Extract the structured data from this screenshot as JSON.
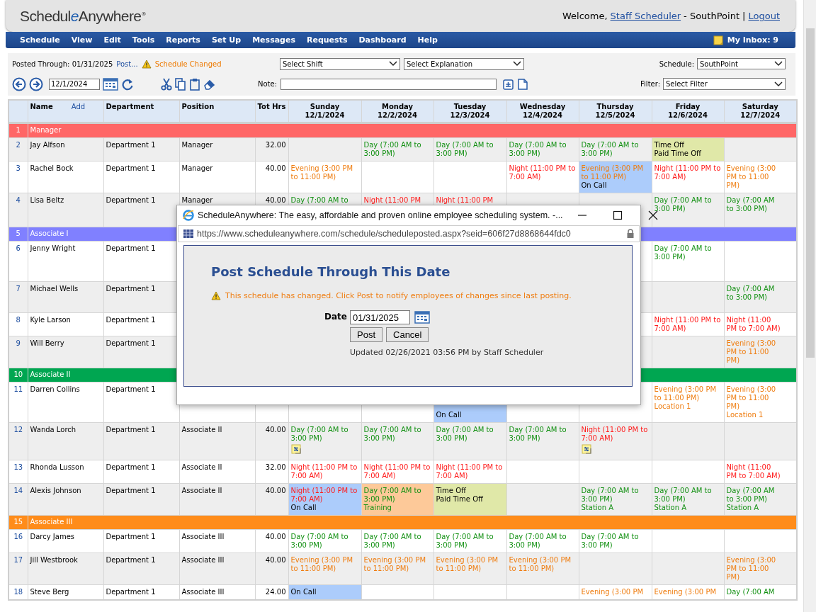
{
  "header": {
    "logo": [
      {
        "text": "Schedul"
      },
      {
        "text": "e",
        "accent": true
      },
      {
        "text": "Anywhere"
      }
    ],
    "logo_mark": "®",
    "welcome": "Welcome,",
    "user_link": "Staff Scheduler",
    "site": "- SouthPoint |",
    "logout_link": "Logout"
  },
  "menu": {
    "items": [
      "Schedule",
      "View",
      "Edit",
      "Tools",
      "Reports",
      "Set Up",
      "Messages",
      "Requests",
      "Dashboard",
      "Help"
    ],
    "inbox": "My Inbox: 9"
  },
  "toolbar": {
    "posted_through": "Posted Through: 01/31/2025",
    "post_link": "Post...",
    "status": "Schedule Changed",
    "shift_select": "Select Shift",
    "explanation_select": "Select Explanation",
    "schedule_label": "Schedule:",
    "schedule_select": "SouthPoint",
    "date_value": "12/1/2024",
    "note_label": "Note:",
    "filter_label": "Filter:",
    "filter_select": "Select Filter"
  },
  "table": {
    "columns": [
      {
        "label": "Name",
        "action": "Add"
      },
      {
        "label": "Department"
      },
      {
        "label": "Position"
      },
      {
        "label": "Tot Hrs"
      }
    ],
    "days": [
      {
        "day": "Sunday",
        "date": "12/1/2024"
      },
      {
        "day": "Monday",
        "date": "12/2/2024"
      },
      {
        "day": "Tuesday",
        "date": "12/3/2024"
      },
      {
        "day": "Wednesday",
        "date": "12/4/2024"
      },
      {
        "day": "Thursday",
        "date": "12/5/2024"
      },
      {
        "day": "Friday",
        "date": "12/6/2024"
      },
      {
        "day": "Saturday",
        "date": "12/7/2024"
      }
    ],
    "rows": [
      {
        "kind": "group",
        "number": "1",
        "label": "Manager",
        "color": "#ff6666"
      },
      {
        "kind": "employee",
        "number": "2",
        "name": "Jay Alfson",
        "department": "Department 1",
        "position": "Manager",
        "hours": "32.00",
        "days": {
          "mon": {
            "lines": [
              {
                "text": "Day (7:00 AM to 3:00 PM)",
                "kind": "day"
              }
            ]
          },
          "tue": {
            "lines": [
              {
                "text": "Day (7:00 AM to 3:00 PM)",
                "kind": "day"
              }
            ]
          },
          "wed": {
            "lines": [
              {
                "text": "Day (7:00 AM to 3:00 PM)",
                "kind": "day"
              }
            ]
          },
          "thu": {
            "lines": [
              {
                "text": "Day (7:00 AM to 3:00 PM)",
                "kind": "day"
              }
            ]
          },
          "fri": {
            "lines": [
              {
                "text": "Time Off",
                "kind": "plain"
              },
              {
                "text": "Paid Time Off",
                "kind": "plain"
              }
            ],
            "color": "#e0e8a8"
          }
        }
      },
      {
        "kind": "employee",
        "number": "3",
        "name": "Rachel Bock",
        "department": "Department 1",
        "position": "Manager",
        "hours": "40.00",
        "days": {
          "sun": {
            "lines": [
              {
                "text": "Evening (3:00 PM to 11:00 PM)",
                "kind": "evening"
              }
            ]
          },
          "wed": {
            "lines": [
              {
                "text": "Night (11:00 PM to 7:00 AM)",
                "kind": "night"
              }
            ]
          },
          "thu": {
            "lines": [
              {
                "text": "Evening (3:00 PM to 11:00 PM)",
                "kind": "evening"
              },
              {
                "text": "On Call",
                "kind": "plain"
              }
            ],
            "color": "#acccfb"
          },
          "fri": {
            "lines": [
              {
                "text": "Night (11:00 PM to 7:00 AM)",
                "kind": "night"
              }
            ]
          },
          "sat": {
            "lines": [
              {
                "text": "Evening (3:00 PM to 11:00 PM)",
                "kind": "evening"
              }
            ]
          }
        }
      },
      {
        "kind": "employee",
        "number": "4",
        "name": "Lisa Beltz",
        "department": "Department 1",
        "position": "Manager",
        "hours": "40.00",
        "days": {
          "sun": {
            "lines": [
              {
                "text": "Day (7:00 AM to",
                "kind": "day"
              }
            ]
          },
          "mon": {
            "lines": [
              {
                "text": "Night (11:00 PM",
                "kind": "night"
              }
            ]
          },
          "tue": {
            "lines": [
              {
                "text": "Night (11:00 PM",
                "kind": "night"
              }
            ]
          },
          "fri": {
            "lines": [
              {
                "text": "Day (7:00 AM to 3:00 PM)",
                "kind": "day"
              }
            ]
          },
          "sat": {
            "lines": [
              {
                "text": "Day (7:00 AM to 3:00 PM)",
                "kind": "day"
              }
            ]
          }
        }
      },
      {
        "kind": "group",
        "number": "5",
        "label": "Associate I",
        "color": "#8080ff"
      },
      {
        "kind": "employee",
        "number": "6",
        "name": "Jenny Wright",
        "department": "Department 1",
        "days": {
          "fri": {
            "lines": [
              {
                "text": "Day (7:00 AM to 3:00 PM)",
                "kind": "day"
              }
            ]
          }
        }
      },
      {
        "kind": "employee",
        "number": "7",
        "name": "Michael Wells",
        "department": "Department 1",
        "days": {
          "sat": {
            "lines": [
              {
                "text": "Day (7:00 AM to 3:00 PM)",
                "kind": "day"
              }
            ]
          }
        }
      },
      {
        "kind": "employee",
        "number": "8",
        "name": "Kyle Larson",
        "department": "Department 1",
        "days": {
          "fri": {
            "lines": [
              {
                "text": "Night (11:00 PM to 7:00 AM)",
                "kind": "night"
              }
            ]
          },
          "sat": {
            "lines": [
              {
                "text": "Night (11:00 PM to 7:00 AM)",
                "kind": "night"
              }
            ]
          }
        }
      },
      {
        "kind": "employee",
        "number": "9",
        "name": "Will Berry",
        "department": "Department 1",
        "days": {
          "sat": {
            "lines": [
              {
                "text": "Evening (3:00 PM to 11:00 PM)",
                "kind": "evening"
              }
            ]
          }
        }
      },
      {
        "kind": "group",
        "number": "10",
        "label": "Associate II",
        "color": "#00a651"
      },
      {
        "kind": "employee",
        "number": "11",
        "name": "Darren Collins",
        "department": "Department 1",
        "days": {
          "tue": {
            "lines": [
              {
                "text": "On Call",
                "kind": "plain"
              }
            ],
            "color": "#acccfb"
          },
          "fri": {
            "lines": [
              {
                "text": "Evening (3:00 PM to 11:00 PM)",
                "kind": "evening"
              },
              {
                "text": "Location 1",
                "kind": "evening"
              }
            ]
          },
          "sat": {
            "lines": [
              {
                "text": "Evening (3:00 PM to 11:00 PM)",
                "kind": "evening"
              },
              {
                "text": "Location 1",
                "kind": "evening"
              }
            ]
          }
        }
      },
      {
        "kind": "employee",
        "number": "12",
        "name": "Wanda Lorch",
        "department": "Department 1",
        "position": "Associate II",
        "hours": "40.00",
        "days": {
          "sun": {
            "lines": [
              {
                "text": "Day (7:00 AM to 3:00 PM)",
                "kind": "day"
              }
            ],
            "note_icon": true
          },
          "mon": {
            "lines": [
              {
                "text": "Day (7:00 AM to 3:00 PM)",
                "kind": "day"
              }
            ]
          },
          "tue": {
            "lines": [
              {
                "text": "Day (7:00 AM to 3:00 PM)",
                "kind": "day"
              }
            ]
          },
          "wed": {
            "lines": [
              {
                "text": "Day (7:00 AM to 3:00 PM)",
                "kind": "day"
              }
            ]
          },
          "thu": {
            "lines": [
              {
                "text": "Night (11:00 PM to 7:00 AM)",
                "kind": "night"
              }
            ],
            "note_icon": true
          }
        }
      },
      {
        "kind": "employee",
        "number": "13",
        "name": "Rhonda Lusson",
        "department": "Department 1",
        "position": "Associate II",
        "hours": "32.00",
        "days": {
          "sun": {
            "lines": [
              {
                "text": "Night (11:00 PM to 7:00 AM)",
                "kind": "night"
              }
            ]
          },
          "mon": {
            "lines": [
              {
                "text": "Night (11:00 PM to 7:00 AM)",
                "kind": "night"
              }
            ]
          },
          "tue": {
            "lines": [
              {
                "text": "Night (11:00 PM to 7:00 AM)",
                "kind": "night"
              }
            ]
          },
          "sat": {
            "lines": [
              {
                "text": "Night (11:00 PM to 7:00 AM)",
                "kind": "night"
              }
            ]
          }
        }
      },
      {
        "kind": "employee",
        "number": "14",
        "name": "Alexis Johnson",
        "department": "Department 1",
        "position": "Associate II",
        "hours": "40.00",
        "days": {
          "sun": {
            "lines": [
              {
                "text": "Night (11:00 PM to 7:00 AM)",
                "kind": "night"
              },
              {
                "text": "On Call",
                "kind": "plain"
              }
            ],
            "color": "#acccfb"
          },
          "mon": {
            "lines": [
              {
                "text": "Day (7:00 AM to 3:00 PM)",
                "kind": "day"
              },
              {
                "text": "Training",
                "kind": "day"
              }
            ],
            "color": "#fdc999"
          },
          "tue": {
            "lines": [
              {
                "text": "Time Off",
                "kind": "plain"
              },
              {
                "text": "Paid Time Off",
                "kind": "plain"
              }
            ],
            "color": "#e0e8a8"
          },
          "thu": {
            "lines": [
              {
                "text": "Day (7:00 AM to 3:00 PM)",
                "kind": "day"
              },
              {
                "text": "Station A",
                "kind": "day"
              }
            ]
          },
          "fri": {
            "lines": [
              {
                "text": "Day (7:00 AM to 3:00 PM)",
                "kind": "day"
              },
              {
                "text": "Station A",
                "kind": "day"
              }
            ]
          },
          "sat": {
            "lines": [
              {
                "text": "Day (7:00 AM to 3:00 PM)",
                "kind": "day"
              },
              {
                "text": "Station A",
                "kind": "day"
              }
            ]
          }
        }
      },
      {
        "kind": "group",
        "number": "15",
        "label": "Associate III",
        "color": "#ff8c1a"
      },
      {
        "kind": "employee",
        "number": "16",
        "name": "Darcy James",
        "department": "Department 1",
        "position": "Associate III",
        "hours": "40.00",
        "days": {
          "sun": {
            "lines": [
              {
                "text": "Day (7:00 AM to 3:00 PM)",
                "kind": "day"
              }
            ]
          },
          "mon": {
            "lines": [
              {
                "text": "Day (7:00 AM to 3:00 PM)",
                "kind": "day"
              }
            ]
          },
          "tue": {
            "lines": [
              {
                "text": "Day (7:00 AM to 3:00 PM)",
                "kind": "day"
              }
            ]
          },
          "wed": {
            "lines": [
              {
                "text": "Day (7:00 AM to 3:00 PM)",
                "kind": "day"
              }
            ]
          },
          "thu": {
            "lines": [
              {
                "text": "Day (7:00 AM to 3:00 PM)",
                "kind": "day"
              }
            ]
          }
        }
      },
      {
        "kind": "employee",
        "number": "17",
        "name": "Jill Westbrook",
        "department": "Department 1",
        "position": "Associate III",
        "hours": "40.00",
        "days": {
          "sun": {
            "lines": [
              {
                "text": "Evening (3:00 PM to 11:00 PM)",
                "kind": "evening"
              }
            ]
          },
          "mon": {
            "lines": [
              {
                "text": "Evening (3:00 PM to 11:00 PM)",
                "kind": "evening"
              }
            ]
          },
          "tue": {
            "lines": [
              {
                "text": "Evening (3:00 PM to 11:00 PM)",
                "kind": "evening"
              }
            ]
          },
          "wed": {
            "lines": [
              {
                "text": "Evening (3:00 PM to 11:00 PM)",
                "kind": "evening"
              }
            ]
          },
          "sat": {
            "lines": [
              {
                "text": "Evening (3:00 PM to 11:00 PM)",
                "kind": "evening"
              }
            ]
          }
        }
      },
      {
        "kind": "employee",
        "number": "18",
        "name": "Steve Berg",
        "department": "Department 1",
        "position": "Associate III",
        "hours": "24.00",
        "days": {
          "sun": {
            "lines": [
              {
                "text": "On Call",
                "kind": "plain"
              }
            ],
            "color": "#acccfb"
          },
          "thu": {
            "lines": [
              {
                "text": "Evening (3:00 PM",
                "kind": "evening"
              }
            ]
          },
          "fri": {
            "lines": [
              {
                "text": "Evening (3:00 PM",
                "kind": "evening"
              }
            ]
          },
          "sat": {
            "lines": [
              {
                "text": "Day (7:00 AM",
                "kind": "day"
              }
            ]
          }
        }
      }
    ]
  },
  "popup": {
    "title": "ScheduleAnywhere: The easy, affordable and proven online employee scheduling system. -...",
    "url": "https://www.scheduleanywhere.com/schedule/scheduleposted.aspx?seid=606f27d8868644fdc0",
    "heading": "Post Schedule Through This Date",
    "warning": "This schedule has changed. Click Post to notify employees of changes since last posting.",
    "date_label": "Date",
    "date_value": "01/31/2025",
    "buttons": [
      "Post",
      "Cancel"
    ],
    "updated": "Updated 02/26/2021 03:56 PM by Staff Scheduler"
  }
}
